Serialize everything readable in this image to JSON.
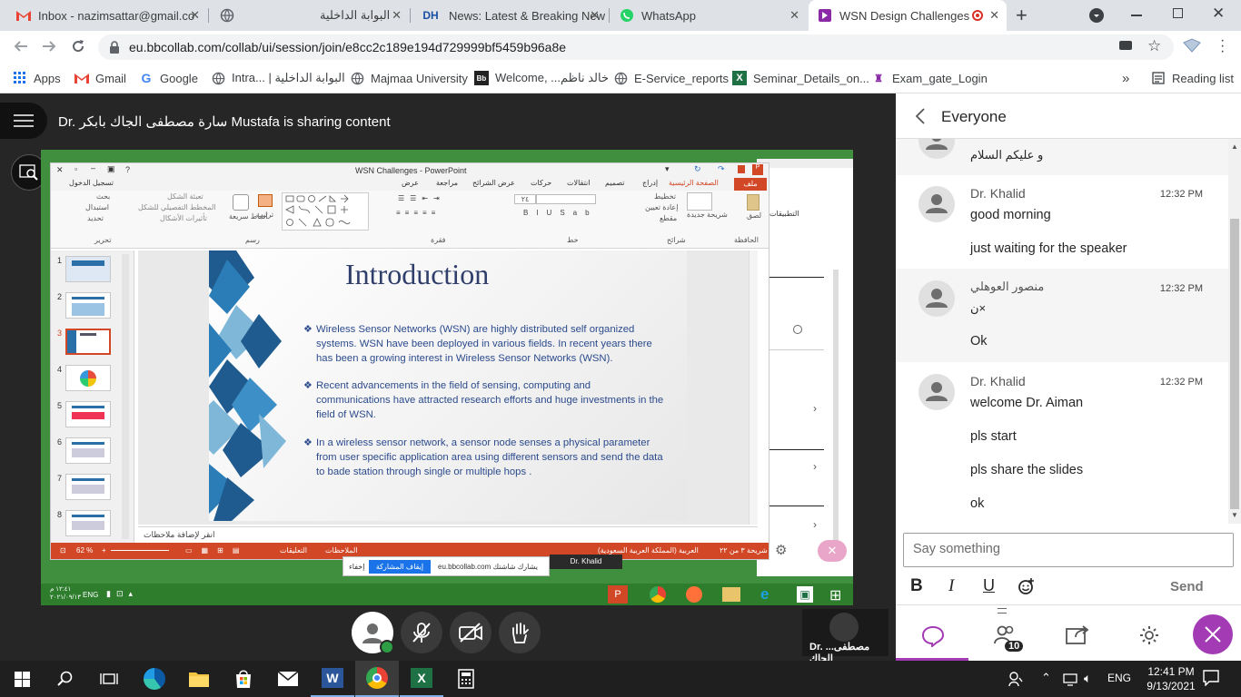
{
  "browser": {
    "tabs": [
      {
        "title": "Inbox - nazimsattar@gmail.co",
        "icon": "gmail-icon"
      },
      {
        "title": "البوابة الداخلية",
        "icon": "globe-icon"
      },
      {
        "title": "News: Latest & Breaking New",
        "icon": "dh-icon",
        "badge": "DH"
      },
      {
        "title": "WhatsApp",
        "icon": "whatsapp-icon"
      },
      {
        "title": "WSN Design Challenges",
        "icon": "collab-icon"
      }
    ],
    "url": "eu.bbcollab.com/collab/ui/session/join/e8cc2c189e194d729999bf5459b96a8e",
    "bookmarks": [
      {
        "label": "Apps"
      },
      {
        "label": "Gmail"
      },
      {
        "label": "Google"
      },
      {
        "label": "Intra... | البوابة الداخلية"
      },
      {
        "label": "Majmaa University"
      },
      {
        "label": "Welcome, ...خالد ناظم"
      },
      {
        "label": "E-Service_reports"
      },
      {
        "label": "Seminar_Details_on..."
      },
      {
        "label": "Exam_gate_Login"
      }
    ],
    "reading_list": "Reading list",
    "bookmark_more": "»"
  },
  "session": {
    "sharing_text": "Dr. سارة مصطفى الجاك بابكر Mustafa is sharing content",
    "presenter_label": "Dr. ...مصطفى الجاك"
  },
  "ppt": {
    "window_title": "WSN Challenges - PowerPoint",
    "signin": "تسجيل الدخول",
    "ribbon_tabs": [
      "ملف",
      "الصفحة الرئيسية",
      "إدراج",
      "تصميم",
      "انتقالات",
      "حركات",
      "عرض الشرائح",
      "مراجعة",
      "عرض"
    ],
    "groups": [
      "الحافظة",
      "شرائح",
      "خط",
      "فقرة",
      "رسم",
      "تحرير"
    ],
    "ribbon_items": [
      "بحث",
      "استبدال",
      "تحديد",
      "تعبئة الشكل",
      "المخطط التفصيلي للشكل",
      "تأثيرات الأشكال",
      "أنماط سريعة",
      "ترتيب",
      "تخطيط",
      "إعادة تعيين",
      "مقطع",
      "شريحة جديدة",
      "لصق"
    ],
    "font_size": "٢٤",
    "slide_numbers": [
      "1",
      "2",
      "3",
      "4",
      "5",
      "6",
      "7",
      "8"
    ],
    "slide": {
      "title": "Introduction",
      "bullets": [
        "Wireless Sensor Networks (WSN) are highly distributed self organized systems. WSN have been deployed in various fields. In recent years there has been a growing interest in Wireless Sensor Networks (WSN).",
        "Recent advancements in the field of sensing, computing and communications have attracted research efforts and huge investments in the field of WSN.",
        "In a wireless sensor network, a sensor node senses a physical parameter from user specific application area using different sensors and send the data to bade station through single or multiple hops ."
      ],
      "bullet_mark": "❖"
    },
    "notes_placeholder": "انقر لإضافة ملاحظات",
    "status": {
      "slide_info": "شريحة ٣ من ٢٢",
      "language": "العربية (المملكة العربية السعودية)",
      "zoom": "62 %",
      "notes_btn": "الملاحظات",
      "comments_btn": "التعليقات"
    },
    "share_notice": {
      "text": "eu.bbcollab.com يشارك شاشتك",
      "stop": "إيقاف المشاركة",
      "hide": "إخفاء"
    },
    "inner_taskbar": {
      "lang": "ENG",
      "time": "١٢:٤١ م",
      "date": "٢٠٢١/٠٩/١٣"
    },
    "behind_window": {
      "apps": "التطبيقات",
      "presenter": "Dr. Khalid"
    }
  },
  "chat": {
    "header": "Everyone",
    "messages": [
      {
        "name": "",
        "time": "",
        "lines": [
          "و عليكم السلام"
        ]
      },
      {
        "name": "Dr. Khalid",
        "time": "12:32 PM",
        "lines": [
          "good morning",
          "just waiting for the speaker"
        ]
      },
      {
        "name": "منصور العوهلي",
        "time": "12:32 PM",
        "lines": [
          "ن×",
          "Ok"
        ]
      },
      {
        "name": "Dr. Khalid",
        "time": "12:32 PM",
        "lines": [
          "welcome Dr. Aiman",
          "pls start",
          "pls share the slides",
          "ok"
        ]
      }
    ],
    "placeholder": "Say something",
    "send": "Send",
    "participant_count": "10"
  },
  "taskbar": {
    "lang": "ENG",
    "time": "12:41 PM",
    "date": "9/13/2021"
  },
  "colors": {
    "accent_purple": "#a33bb5",
    "ppt_orange": "#d24726",
    "slide_blue": "#2b4a8c",
    "green_desktop": "#3f8f3f"
  }
}
